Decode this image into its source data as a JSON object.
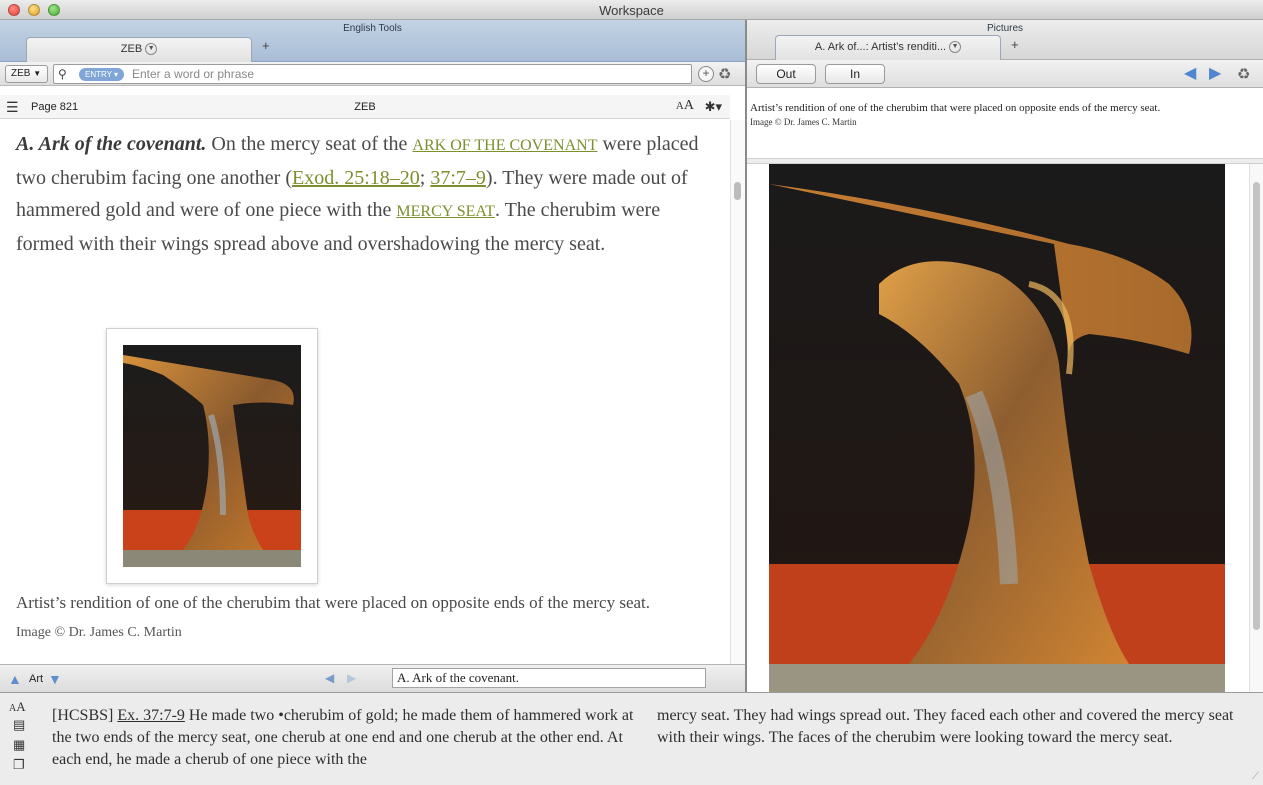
{
  "window": {
    "title": "Workspace"
  },
  "left_pane": {
    "title": "English Tools",
    "tab_label": "ZEB",
    "resource_select": "ZEB",
    "search_mode": "ENTRY",
    "search_placeholder": "Enter a word or phrase",
    "page_label": "Page 821",
    "resource_title": "ZEB",
    "font_size_label": "AA",
    "article": {
      "headword": "A. Ark of the covenant.",
      "text1": " On the mercy seat of the ",
      "link_ark": "ARK OF THE COVENANT",
      "text2": " were placed two cherubim facing one another (",
      "link_exod": "Exod. 25:18–20",
      "text3": "; ",
      "link_37": "37:7–9",
      "text4": "). They were made out of hammered gold and were of one piece with the ",
      "link_mercy": "MERCY SEAT",
      "text5": ". The cherubim were formed with their wings spread above and overshadowing the mercy seat.",
      "caption": "Artist’s rendition of one of the cherubim that were placed on opposite ends of the mercy seat.",
      "credit": "Image © Dr. James C. Martin"
    },
    "bottom": {
      "field_label": "Art",
      "location": "A. Ark of the covenant."
    }
  },
  "right_pane": {
    "title": "Pictures",
    "tab_label": "A. Ark of...: Artist’s renditi...",
    "zoom_out": "Out",
    "zoom_in": "In",
    "caption": "Artist’s rendition of one of the cherubim that were placed on opposite ends of the mercy seat.",
    "credit": "Image © Dr. James C. Martin"
  },
  "bottom_pane": {
    "version": "[HCSBS]",
    "reference": "Ex. 37:7-9",
    "col1": " He made two •cherubim of gold; he made them of hammered work at the two ends of the mercy seat, one cherub at one end and one cherub at the other end. At each end, he made a cherub of one piece with the",
    "col2": "mercy seat. They had wings spread out. They faced each other and covered the mercy seat with their wings. The faces of the cherubim were looking toward the mercy seat."
  }
}
